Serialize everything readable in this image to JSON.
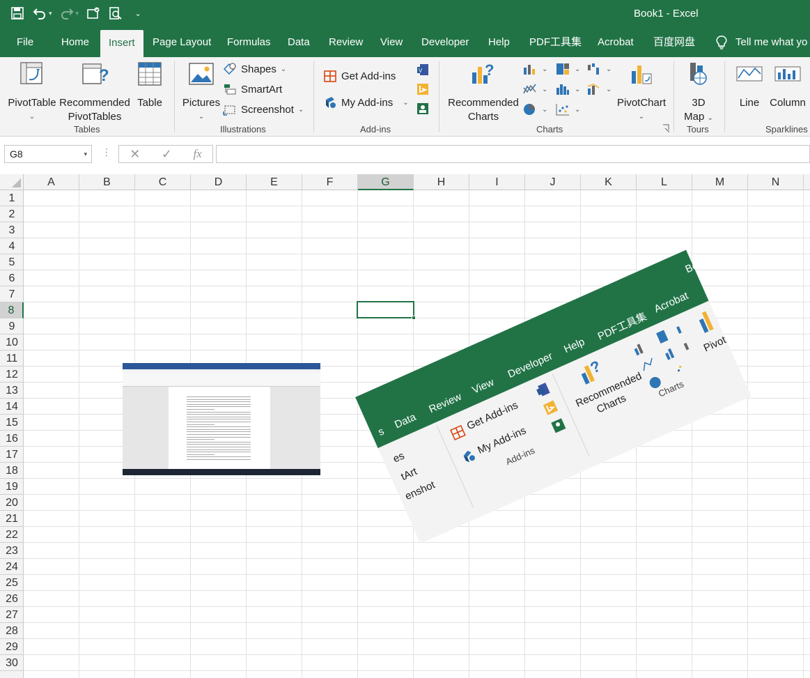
{
  "window": {
    "title": "Book1  -  Excel"
  },
  "tabs": [
    "File",
    "Home",
    "Insert",
    "Page Layout",
    "Formulas",
    "Data",
    "Review",
    "View",
    "Developer",
    "Help",
    "PDF工具集",
    "Acrobat",
    "百度网盘"
  ],
  "active_tab": "Insert",
  "tell_me": "Tell me what yo",
  "ribbon": {
    "tables": {
      "label": "Tables",
      "pivottable": "PivotTable",
      "recommended_pivot": [
        "Recommended",
        "PivotTables"
      ],
      "table": "Table"
    },
    "illustrations": {
      "label": "Illustrations",
      "pictures": "Pictures",
      "shapes": "Shapes",
      "smartart": "SmartArt",
      "screenshot": "Screenshot"
    },
    "addins": {
      "label": "Add-ins",
      "get": "Get Add-ins",
      "my": "My Add-ins"
    },
    "charts": {
      "label": "Charts",
      "recommended": [
        "Recommended",
        "Charts"
      ],
      "pivotchart": "PivotChart"
    },
    "tours": {
      "label": "Tours",
      "map3d": [
        "3D",
        "Map"
      ]
    },
    "sparklines": {
      "label": "Sparklines",
      "line": "Line",
      "column": "Column"
    }
  },
  "formula_bar": {
    "name_box": "G8",
    "fx": "fx",
    "value": ""
  },
  "grid": {
    "columns": [
      "A",
      "B",
      "C",
      "D",
      "E",
      "F",
      "G",
      "H",
      "I",
      "J",
      "K",
      "L",
      "M",
      "N"
    ],
    "rows": [
      "1",
      "2",
      "3",
      "4",
      "5",
      "6",
      "7",
      "8",
      "9",
      "10",
      "11",
      "12",
      "13",
      "14",
      "15",
      "16",
      "17",
      "18",
      "19",
      "20",
      "21",
      "22",
      "23",
      "24",
      "25",
      "26",
      "27",
      "28",
      "29",
      "30"
    ],
    "selected_col": "G",
    "selected_row": "8"
  },
  "rotated_image": {
    "tabs": [
      "s",
      "Data",
      "Review",
      "View",
      "Developer",
      "Help",
      "PDF工具集",
      "Acrobat",
      "Boo"
    ],
    "items": {
      "get": "Get Add-ins",
      "my": "My Add-ins",
      "addins_label": "Add-ins",
      "recommended": [
        "Recommended",
        "Charts"
      ],
      "charts_label": "Charts",
      "pivot": "PivotCh",
      "shapes": "es",
      "smartart": "tArt",
      "screenshot": "enshot"
    }
  }
}
